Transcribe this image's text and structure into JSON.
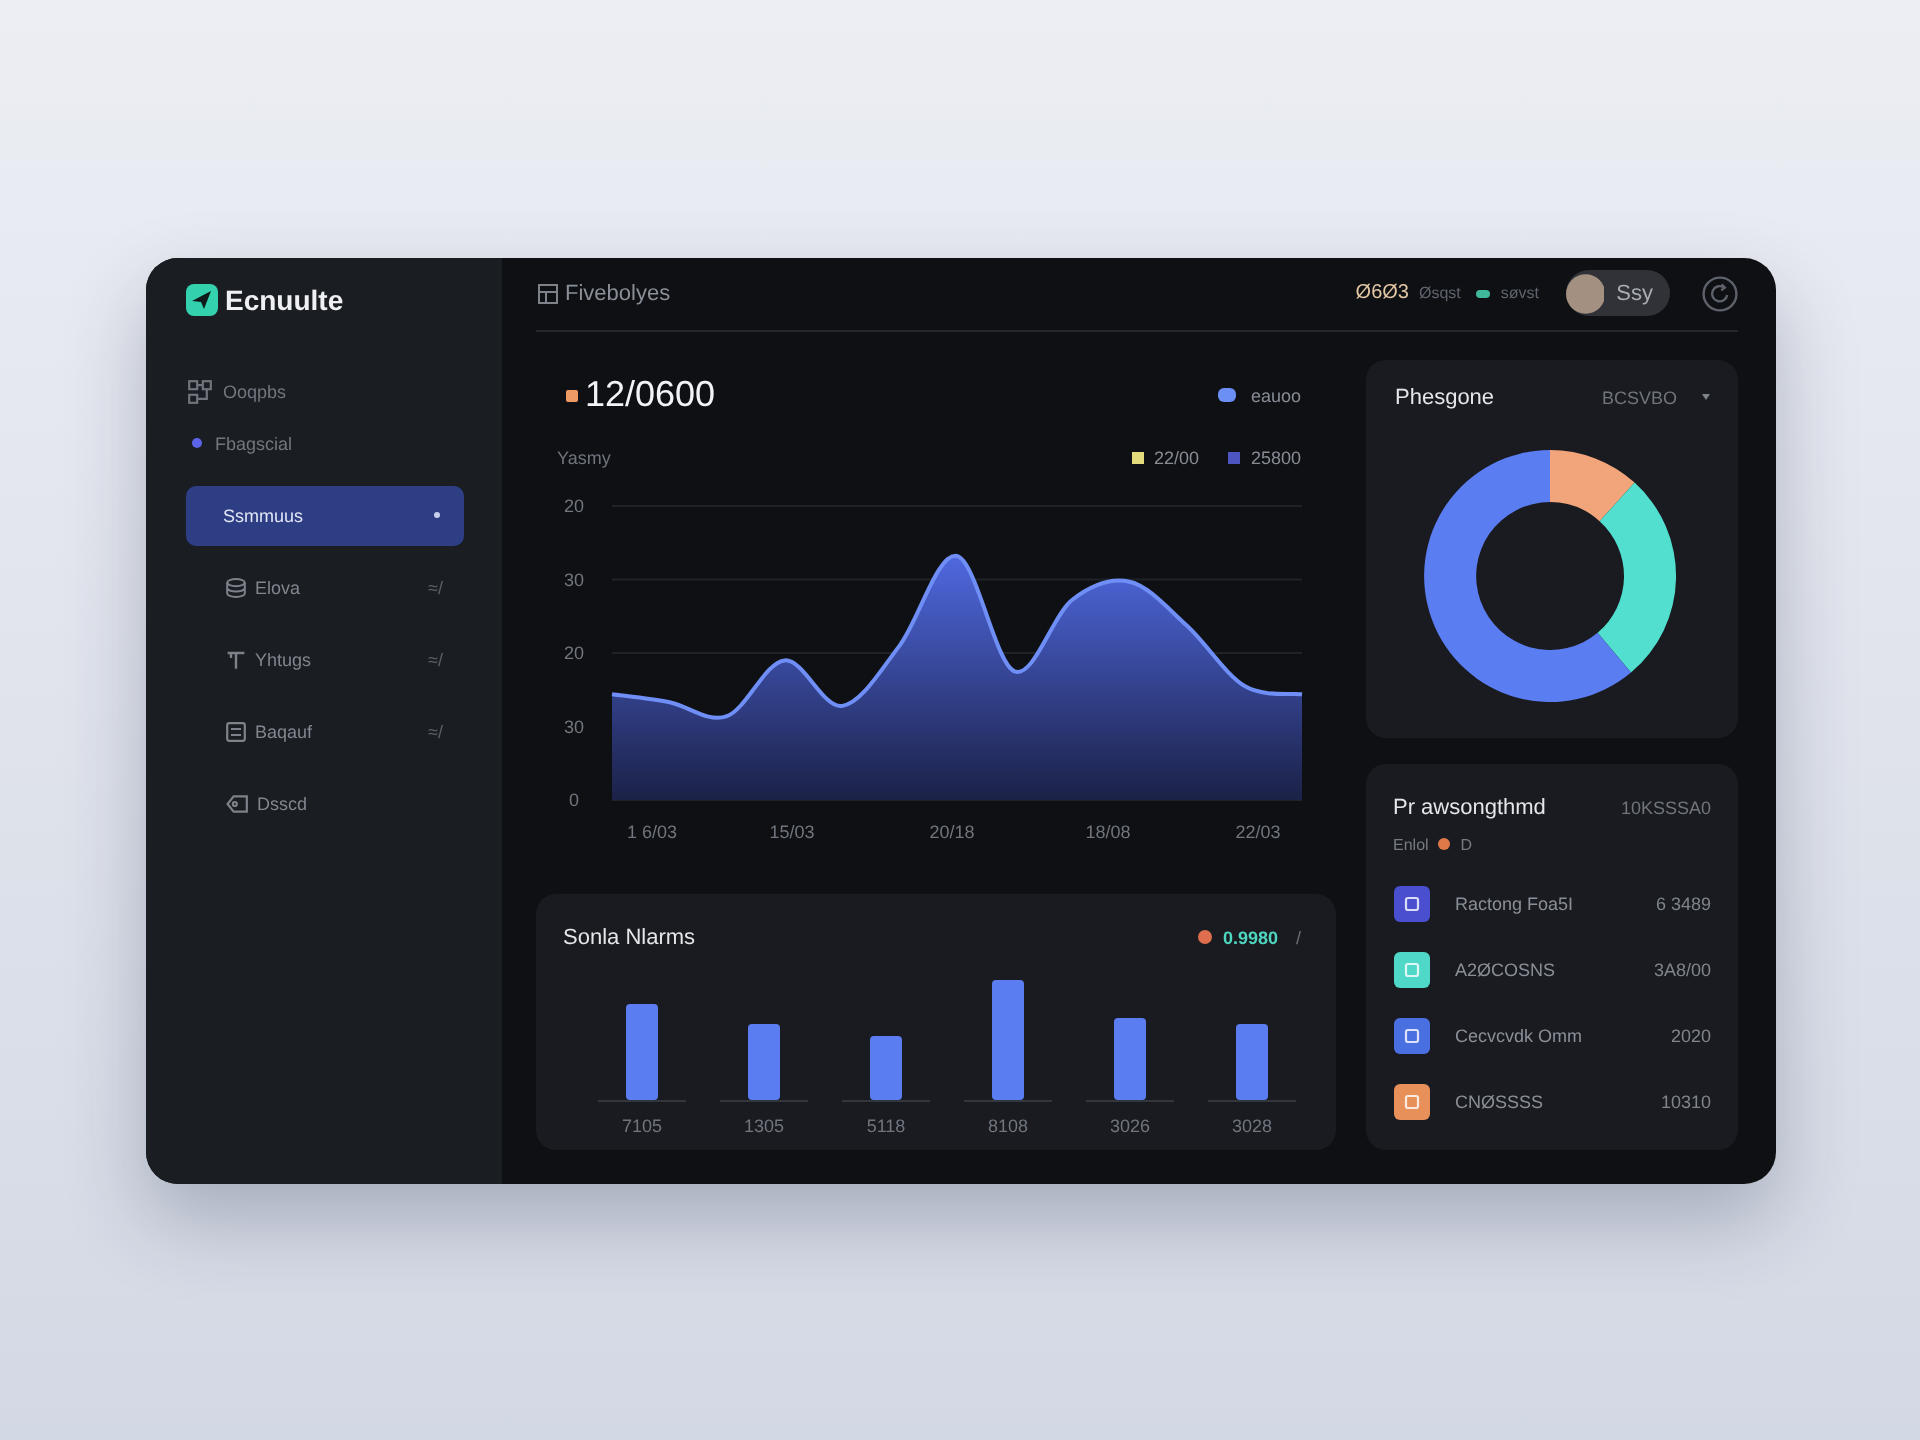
{
  "sidebar": {
    "logo": "Ecnuulte",
    "sections": [
      {
        "label": "Ooqpbs",
        "kind": "icon"
      },
      {
        "label": "Fbagscial",
        "kind": "dot"
      }
    ],
    "items": [
      {
        "label": "Ssmmuus",
        "selected": true
      },
      {
        "label": "Elova",
        "selected": false,
        "badge": "≈/"
      },
      {
        "label": "Yhtugs",
        "selected": false,
        "badge": "≈/"
      },
      {
        "label": "Baqauf",
        "selected": false,
        "badge": "≈/"
      },
      {
        "label": "Dsscd",
        "selected": false
      }
    ]
  },
  "topbar": {
    "breadcrumb": "Fivebolyes",
    "stat": "Ø6Ø3",
    "stat_label": "Øsqst",
    "status": "søvst",
    "user": "Ssy"
  },
  "main_chart": {
    "headline": "12/0600",
    "badge": {
      "label": "eauoo",
      "color": "#6b8ff5"
    },
    "axis_title": "Yasmy",
    "legend": [
      {
        "label": "22/00",
        "color": "#e4dc7a"
      },
      {
        "label": "25800",
        "color": "#4d55c0"
      }
    ],
    "y_labels": [
      "20",
      "30",
      "20",
      "30",
      "0"
    ],
    "x_labels": [
      "1 6/03",
      "15/03",
      "20/18",
      "18/08",
      "22/03"
    ]
  },
  "bar_card": {
    "title": "Sonla Nlarms",
    "reading": "0.9980",
    "trend": "/",
    "categories": [
      "7105",
      "1305",
      "5118",
      "8108",
      "3026",
      "3028"
    ]
  },
  "donut_card": {
    "title": "Phesgone",
    "filter": "BCSVBO"
  },
  "list_card": {
    "title": "Pr awsongthmd",
    "total": "10KSSSA0",
    "subtitle": "Enlol",
    "sub_value": "D",
    "rows": [
      {
        "label": "Ractong Foa5I",
        "value": "6 3489",
        "color": "#4a4fcf"
      },
      {
        "label": "A2ØCOSNS",
        "value": "3A8/00",
        "color": "#4fd8c8"
      },
      {
        "label": "Cecvcvdk Omm",
        "value": "2020",
        "color": "#4a6fe0"
      },
      {
        "label": "CNØSSSS",
        "value": "10310",
        "color": "#e8905a"
      }
    ]
  }
}
